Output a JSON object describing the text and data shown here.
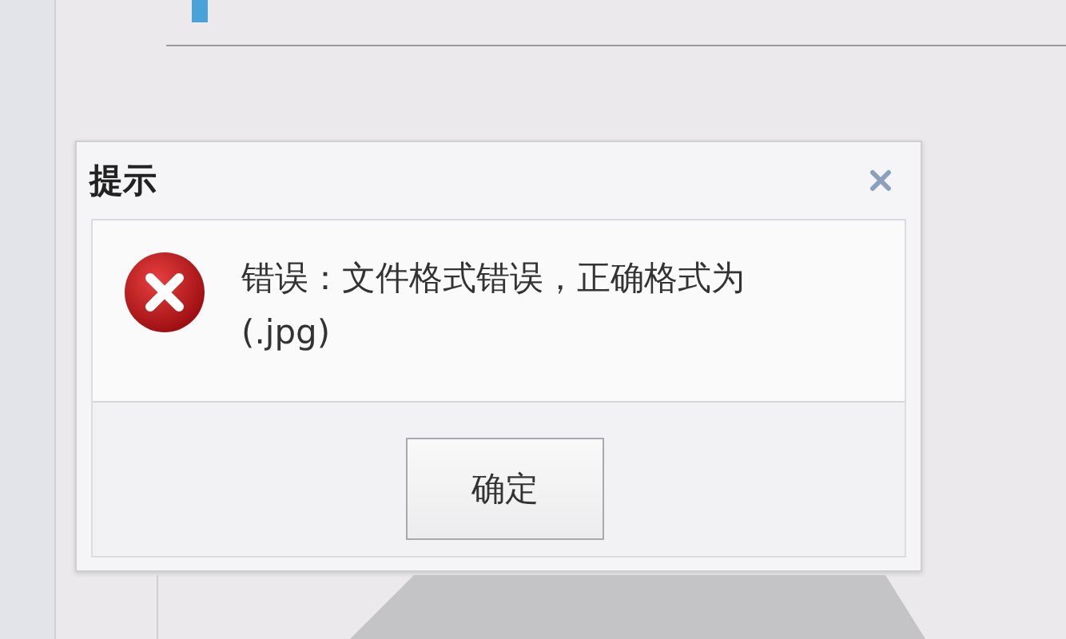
{
  "dialog": {
    "title": "提示",
    "message": "错误：文件格式错误，正确格式为(.jpg)",
    "buttons": [
      "确定"
    ]
  }
}
